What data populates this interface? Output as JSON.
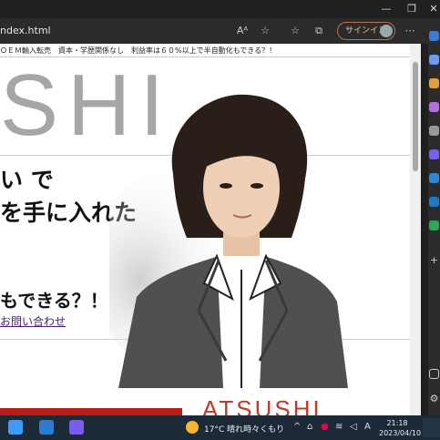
{
  "browser": {
    "url": "ndex.html",
    "signin_label": "サインイン"
  },
  "page": {
    "marquee": "ＯＥＭ輸入転売　資本・学歴関係なし　利益率は６０%以上で半自動化もできる？！",
    "big_title": "SHI",
    "headline_line1": "い で",
    "headline_line2": "を手に入れた",
    "catch": "もできる？！",
    "contact_link": "お問い合わせ",
    "footer_name": "ATSUSHI"
  },
  "taskbar": {
    "weather": "17°C  晴れ時々くもり",
    "ime": "A",
    "time": "21:18",
    "date": "2023/04/10"
  },
  "colors": {
    "accent_red": "#b81d15",
    "signin_border": "#b9734a",
    "taskbar": "#1c2a38"
  }
}
